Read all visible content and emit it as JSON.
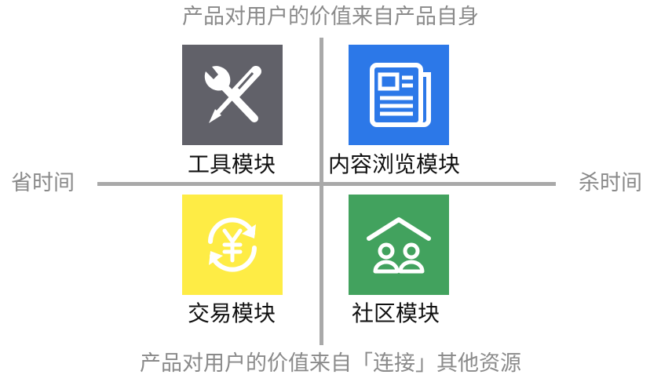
{
  "axes": {
    "top": "产品对用户的价值来自产品自身",
    "bottom": "产品对用户的价值来自「连接」其他资源",
    "left": "省时间",
    "right": "杀时间"
  },
  "quadrants": {
    "tools": {
      "label": "工具模块",
      "icon": "tools-icon",
      "color": "#616169"
    },
    "content": {
      "label": "内容浏览模块",
      "icon": "newspaper-icon",
      "color": "#2c78e8"
    },
    "trade": {
      "label": "交易模块",
      "icon": "yuan-exchange-icon",
      "color": "#feec45"
    },
    "community": {
      "label": "社区模块",
      "icon": "community-icon",
      "color": "#42a25e"
    }
  }
}
